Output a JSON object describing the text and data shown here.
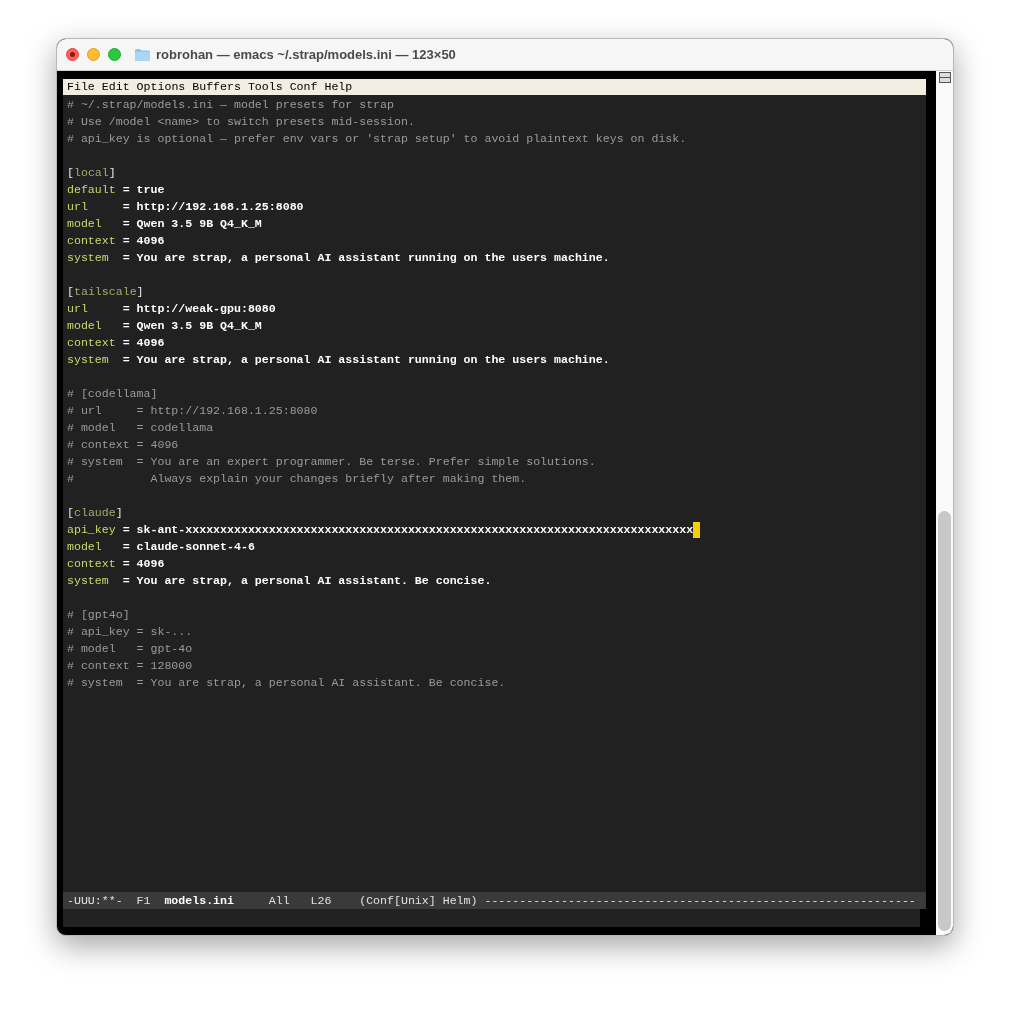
{
  "window": {
    "title": "robrohan — emacs ~/.strap/models.ini — 123×50"
  },
  "menu_bar": [
    "File",
    "Edit",
    "Options",
    "Buffers",
    "Tools",
    "Conf",
    "Help"
  ],
  "lines": [
    {
      "kind": "comment",
      "text": "# ~/.strap/models.ini — model presets for strap"
    },
    {
      "kind": "comment",
      "text": "# Use /model <name> to switch presets mid-session."
    },
    {
      "kind": "comment",
      "text": "# api_key is optional — prefer env vars or 'strap setup' to avoid plaintext keys on disk."
    },
    {
      "kind": "blank"
    },
    {
      "kind": "section",
      "open": "[",
      "name": "local",
      "close": "]"
    },
    {
      "kind": "setting",
      "key": "default",
      "value": "= true",
      "cursor": false
    },
    {
      "kind": "setting",
      "key": "url",
      "value": "= http://192.168.1.25:8080",
      "cursor": false
    },
    {
      "kind": "setting",
      "key": "model",
      "value": "= Qwen 3.5 9B Q4_K_M",
      "cursor": false
    },
    {
      "kind": "setting",
      "key": "context",
      "value": "= 4096",
      "cursor": false
    },
    {
      "kind": "setting",
      "key": "system",
      "value": "= You are strap, a personal AI assistant running on the users machine.",
      "cursor": false
    },
    {
      "kind": "blank"
    },
    {
      "kind": "section",
      "open": "[",
      "name": "tailscale",
      "close": "]"
    },
    {
      "kind": "setting",
      "key": "url",
      "value": "= http://weak-gpu:8080",
      "cursor": false
    },
    {
      "kind": "setting",
      "key": "model",
      "value": "= Qwen 3.5 9B Q4_K_M",
      "cursor": false
    },
    {
      "kind": "setting",
      "key": "context",
      "value": "= 4096",
      "cursor": false
    },
    {
      "kind": "setting",
      "key": "system",
      "value": "= You are strap, a personal AI assistant running on the users machine.",
      "cursor": false
    },
    {
      "kind": "blank"
    },
    {
      "kind": "comment",
      "text": "# [codellama]"
    },
    {
      "kind": "comment",
      "text": "# url     = http://192.168.1.25:8080"
    },
    {
      "kind": "comment",
      "text": "# model   = codellama"
    },
    {
      "kind": "comment",
      "text": "# context = 4096"
    },
    {
      "kind": "comment",
      "text": "# system  = You are an expert programmer. Be terse. Prefer simple solutions."
    },
    {
      "kind": "comment",
      "text": "#           Always explain your changes briefly after making them."
    },
    {
      "kind": "blank"
    },
    {
      "kind": "section",
      "open": "[",
      "name": "claude",
      "close": "]"
    },
    {
      "kind": "setting",
      "key": "api_key",
      "value": "= sk-ant-xxxxxxxxxxxxxxxxxxxxxxxxxxxxxxxxxxxxxxxxxxxxxxxxxxxxxxxxxxxxxxxxxxxxxxxxx",
      "cursor": true
    },
    {
      "kind": "setting",
      "key": "model",
      "value": "= claude-sonnet-4-6",
      "cursor": false
    },
    {
      "kind": "setting",
      "key": "context",
      "value": "= 4096",
      "cursor": false
    },
    {
      "kind": "setting",
      "key": "system",
      "value": "= You are strap, a personal AI assistant. Be concise.",
      "cursor": false
    },
    {
      "kind": "blank"
    },
    {
      "kind": "comment",
      "text": "# [gpt4o]"
    },
    {
      "kind": "comment",
      "text": "# api_key = sk-..."
    },
    {
      "kind": "comment",
      "text": "# model   = gpt-4o"
    },
    {
      "kind": "comment",
      "text": "# context = 128000"
    },
    {
      "kind": "comment",
      "text": "# system  = You are strap, a personal AI assistant. Be concise."
    }
  ],
  "mode_line": {
    "status": "-UUU:**-",
    "frame": "F1",
    "buffer": "models.ini",
    "position": "All",
    "line": "L26",
    "modes": "(Conf[Unix] Helm)",
    "fill": "--------------------------------------------------------------"
  }
}
